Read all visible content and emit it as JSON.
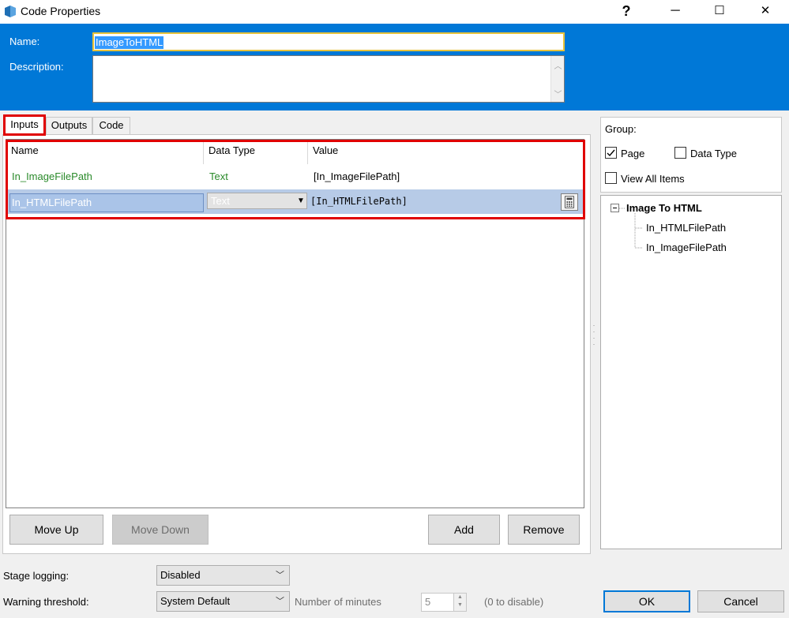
{
  "window": {
    "title": "Code Properties",
    "help_glyph": "?",
    "minimize_glyph": "─",
    "maximize_glyph": "☐",
    "close_glyph": "✕",
    "icon": "app-icon"
  },
  "header": {
    "name_label": "Name:",
    "name_value": "ImageToHTML",
    "description_label": "Description:",
    "description_value": ""
  },
  "tabs": [
    {
      "label": "Inputs",
      "active": true
    },
    {
      "label": "Outputs",
      "active": false
    },
    {
      "label": "Code",
      "active": false
    }
  ],
  "grid": {
    "columns": [
      "Name",
      "Data Type",
      "Value"
    ],
    "rows": [
      {
        "name": "In_ImageFilePath",
        "type": "Text",
        "value": "[In_ImageFilePath]"
      },
      {
        "name": "In_HTMLFilePath",
        "type": "Text",
        "value": "[In_HTMLFilePath]"
      }
    ],
    "row_text_color": "#2a8a2a"
  },
  "buttons": {
    "move_up": "Move Up",
    "move_down": "Move Down",
    "add": "Add",
    "remove": "Remove",
    "ok": "OK",
    "cancel": "Cancel"
  },
  "group": {
    "label": "Group:",
    "page": {
      "label": "Page",
      "checked": true
    },
    "data_type": {
      "label": "Data Type",
      "checked": false
    },
    "view_all": {
      "label": "View All Items",
      "checked": false
    }
  },
  "tree": {
    "root": "Image To HTML",
    "children": [
      "In_HTMLFilePath",
      "In_ImageFilePath"
    ]
  },
  "footer": {
    "stage_logging_label": "Stage logging:",
    "stage_logging_value": "Disabled",
    "warning_threshold_label": "Warning threshold:",
    "warning_threshold_value": "System Default",
    "minutes_label": "Number of minutes",
    "minutes_value": "5",
    "disable_hint": "(0 to disable)"
  },
  "colors": {
    "header_blue": "#0078d7",
    "highlight_red": "#e00000",
    "selected_row": "#b7cbe7"
  }
}
